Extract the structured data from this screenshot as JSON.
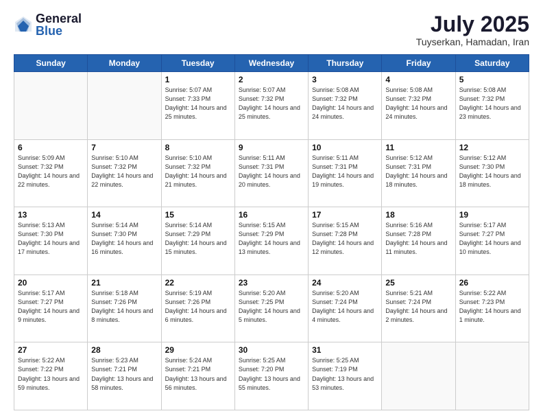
{
  "logo": {
    "general": "General",
    "blue": "Blue"
  },
  "title": {
    "month_year": "July 2025",
    "location": "Tuyserkan, Hamadan, Iran"
  },
  "days_of_week": [
    "Sunday",
    "Monday",
    "Tuesday",
    "Wednesday",
    "Thursday",
    "Friday",
    "Saturday"
  ],
  "weeks": [
    [
      {
        "day": "",
        "info": ""
      },
      {
        "day": "",
        "info": ""
      },
      {
        "day": "1",
        "info": "Sunrise: 5:07 AM\nSunset: 7:33 PM\nDaylight: 14 hours and 25 minutes."
      },
      {
        "day": "2",
        "info": "Sunrise: 5:07 AM\nSunset: 7:32 PM\nDaylight: 14 hours and 25 minutes."
      },
      {
        "day": "3",
        "info": "Sunrise: 5:08 AM\nSunset: 7:32 PM\nDaylight: 14 hours and 24 minutes."
      },
      {
        "day": "4",
        "info": "Sunrise: 5:08 AM\nSunset: 7:32 PM\nDaylight: 14 hours and 24 minutes."
      },
      {
        "day": "5",
        "info": "Sunrise: 5:08 AM\nSunset: 7:32 PM\nDaylight: 14 hours and 23 minutes."
      }
    ],
    [
      {
        "day": "6",
        "info": "Sunrise: 5:09 AM\nSunset: 7:32 PM\nDaylight: 14 hours and 22 minutes."
      },
      {
        "day": "7",
        "info": "Sunrise: 5:10 AM\nSunset: 7:32 PM\nDaylight: 14 hours and 22 minutes."
      },
      {
        "day": "8",
        "info": "Sunrise: 5:10 AM\nSunset: 7:32 PM\nDaylight: 14 hours and 21 minutes."
      },
      {
        "day": "9",
        "info": "Sunrise: 5:11 AM\nSunset: 7:31 PM\nDaylight: 14 hours and 20 minutes."
      },
      {
        "day": "10",
        "info": "Sunrise: 5:11 AM\nSunset: 7:31 PM\nDaylight: 14 hours and 19 minutes."
      },
      {
        "day": "11",
        "info": "Sunrise: 5:12 AM\nSunset: 7:31 PM\nDaylight: 14 hours and 18 minutes."
      },
      {
        "day": "12",
        "info": "Sunrise: 5:12 AM\nSunset: 7:30 PM\nDaylight: 14 hours and 18 minutes."
      }
    ],
    [
      {
        "day": "13",
        "info": "Sunrise: 5:13 AM\nSunset: 7:30 PM\nDaylight: 14 hours and 17 minutes."
      },
      {
        "day": "14",
        "info": "Sunrise: 5:14 AM\nSunset: 7:30 PM\nDaylight: 14 hours and 16 minutes."
      },
      {
        "day": "15",
        "info": "Sunrise: 5:14 AM\nSunset: 7:29 PM\nDaylight: 14 hours and 15 minutes."
      },
      {
        "day": "16",
        "info": "Sunrise: 5:15 AM\nSunset: 7:29 PM\nDaylight: 14 hours and 13 minutes."
      },
      {
        "day": "17",
        "info": "Sunrise: 5:15 AM\nSunset: 7:28 PM\nDaylight: 14 hours and 12 minutes."
      },
      {
        "day": "18",
        "info": "Sunrise: 5:16 AM\nSunset: 7:28 PM\nDaylight: 14 hours and 11 minutes."
      },
      {
        "day": "19",
        "info": "Sunrise: 5:17 AM\nSunset: 7:27 PM\nDaylight: 14 hours and 10 minutes."
      }
    ],
    [
      {
        "day": "20",
        "info": "Sunrise: 5:17 AM\nSunset: 7:27 PM\nDaylight: 14 hours and 9 minutes."
      },
      {
        "day": "21",
        "info": "Sunrise: 5:18 AM\nSunset: 7:26 PM\nDaylight: 14 hours and 8 minutes."
      },
      {
        "day": "22",
        "info": "Sunrise: 5:19 AM\nSunset: 7:26 PM\nDaylight: 14 hours and 6 minutes."
      },
      {
        "day": "23",
        "info": "Sunrise: 5:20 AM\nSunset: 7:25 PM\nDaylight: 14 hours and 5 minutes."
      },
      {
        "day": "24",
        "info": "Sunrise: 5:20 AM\nSunset: 7:24 PM\nDaylight: 14 hours and 4 minutes."
      },
      {
        "day": "25",
        "info": "Sunrise: 5:21 AM\nSunset: 7:24 PM\nDaylight: 14 hours and 2 minutes."
      },
      {
        "day": "26",
        "info": "Sunrise: 5:22 AM\nSunset: 7:23 PM\nDaylight: 14 hours and 1 minute."
      }
    ],
    [
      {
        "day": "27",
        "info": "Sunrise: 5:22 AM\nSunset: 7:22 PM\nDaylight: 13 hours and 59 minutes."
      },
      {
        "day": "28",
        "info": "Sunrise: 5:23 AM\nSunset: 7:21 PM\nDaylight: 13 hours and 58 minutes."
      },
      {
        "day": "29",
        "info": "Sunrise: 5:24 AM\nSunset: 7:21 PM\nDaylight: 13 hours and 56 minutes."
      },
      {
        "day": "30",
        "info": "Sunrise: 5:25 AM\nSunset: 7:20 PM\nDaylight: 13 hours and 55 minutes."
      },
      {
        "day": "31",
        "info": "Sunrise: 5:25 AM\nSunset: 7:19 PM\nDaylight: 13 hours and 53 minutes."
      },
      {
        "day": "",
        "info": ""
      },
      {
        "day": "",
        "info": ""
      }
    ]
  ]
}
